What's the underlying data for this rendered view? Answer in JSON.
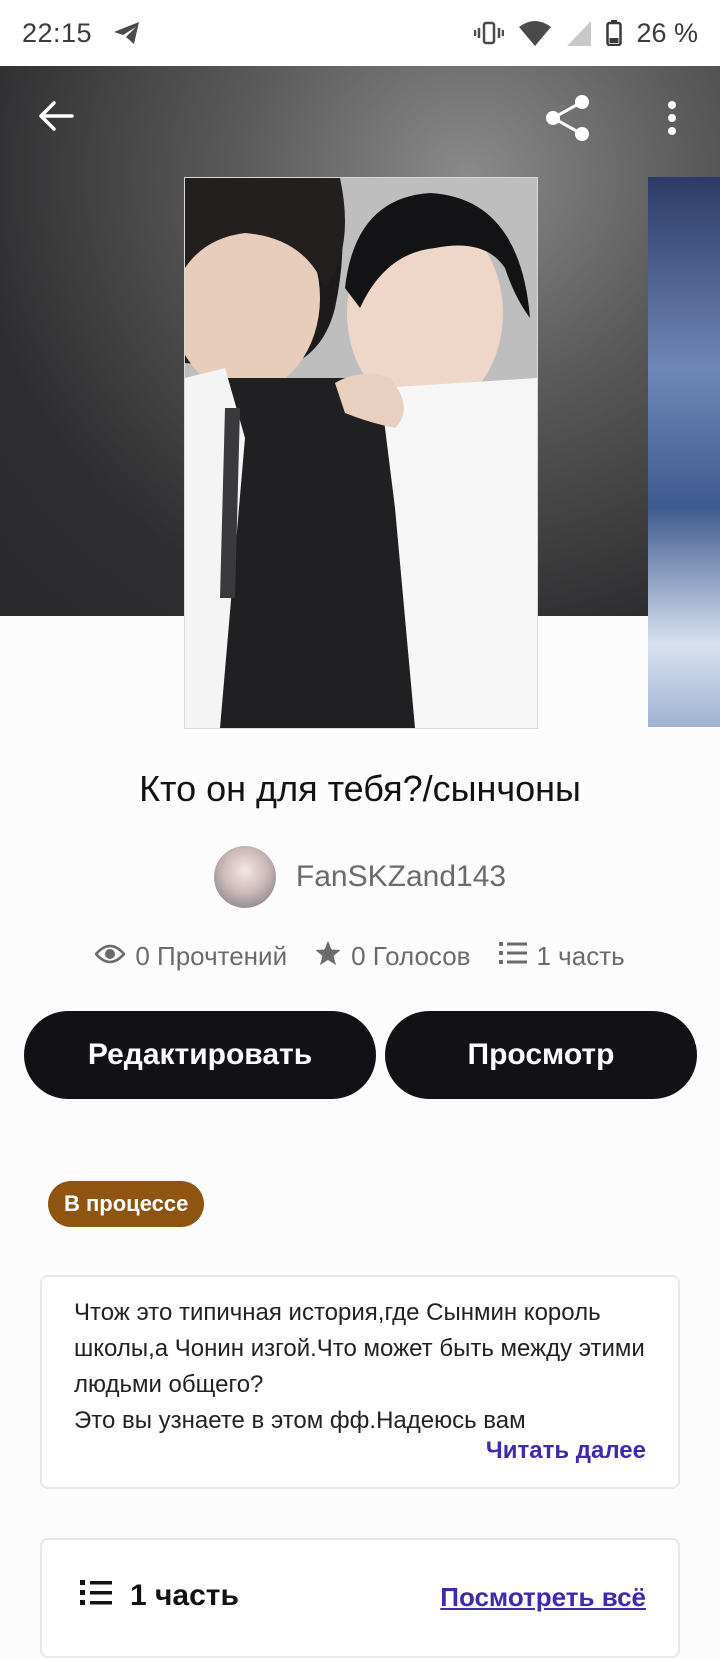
{
  "status_bar": {
    "time": "22:15",
    "battery": "26 %",
    "icons": [
      "telegram-icon",
      "vibrate-icon",
      "wifi-icon",
      "signal-icon",
      "battery-icon"
    ]
  },
  "toolbar": {
    "icons": [
      "back-arrow-icon",
      "share-icon",
      "more-vertical-icon"
    ]
  },
  "story": {
    "title": "Кто он для тебя?/сынчоны",
    "author": "FanSKZand143",
    "stats": {
      "reads": "0 Прочтений",
      "votes": "0 Голосов",
      "parts": "1 часть"
    },
    "status_badge": "В процессе",
    "description": "Чтож это типичная история,где Сынмин король школы,а Чонин изгой.Что может быть между этими людьми общего?\nЭто вы узнаете в этом фф.Надеюсь вам",
    "read_more": "Читать далее"
  },
  "actions": {
    "edit_label": "Редактировать",
    "view_label": "Просмотр"
  },
  "parts_section": {
    "label": "1 часть",
    "view_all": "Посмотреть всё"
  },
  "colors": {
    "button_bg": "#121116",
    "badge_bg": "#8f5410",
    "link": "#3b2bb0"
  }
}
